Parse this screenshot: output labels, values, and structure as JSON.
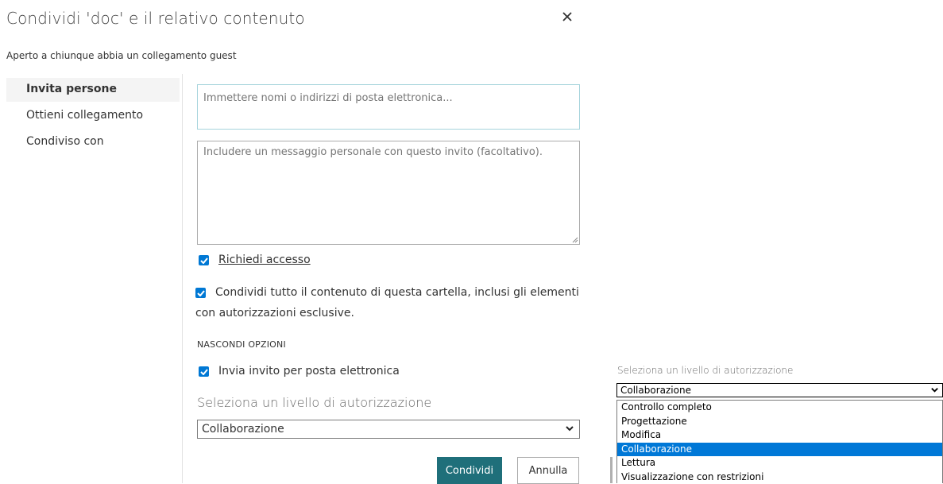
{
  "dialog": {
    "title": "Condividi 'doc' e il relativo contenuto",
    "subtitle": "Aperto a chiunque abbia un collegamento guest",
    "close_icon": "close-icon"
  },
  "nav": {
    "items": [
      {
        "label": "Invita persone",
        "active": true
      },
      {
        "label": "Ottieni collegamento",
        "active": false
      },
      {
        "label": "Condiviso con",
        "active": false
      }
    ]
  },
  "form": {
    "recipients_placeholder": "Immettere nomi o indirizzi di posta elettronica...",
    "message_placeholder": "Includere un messaggio personale con questo invito (facoltativo).",
    "request_access": {
      "label": "Richiedi accesso",
      "checked": true
    },
    "share_all": {
      "label_line1": "Condividi tutto il contenuto di questa cartella, inclusi gli elementi",
      "label_line2": "con autorizzazioni esclusive.",
      "checked": true
    },
    "hide_options": "NASCONDI OPZIONI",
    "send_invite": {
      "label": "Invia invito per posta elettronica",
      "checked": true
    },
    "permission_label": "Seleziona un livello di autorizzazione",
    "permission_value": "Collaborazione",
    "share_button": "Condividi",
    "cancel_button": "Annulla"
  },
  "dropdown_preview": {
    "label": "Seleziona un livello di autorizzazione",
    "selected": "Collaborazione",
    "options": [
      "Controllo completo",
      "Progettazione",
      "Modifica",
      "Collaborazione",
      "Lettura",
      "Visualizzazione con restrizioni"
    ],
    "highlighted_index": 3
  },
  "colors": {
    "accent_checkbox": "#0078d4",
    "primary_button": "#1f6f7a",
    "option_highlight": "#0078d7"
  }
}
